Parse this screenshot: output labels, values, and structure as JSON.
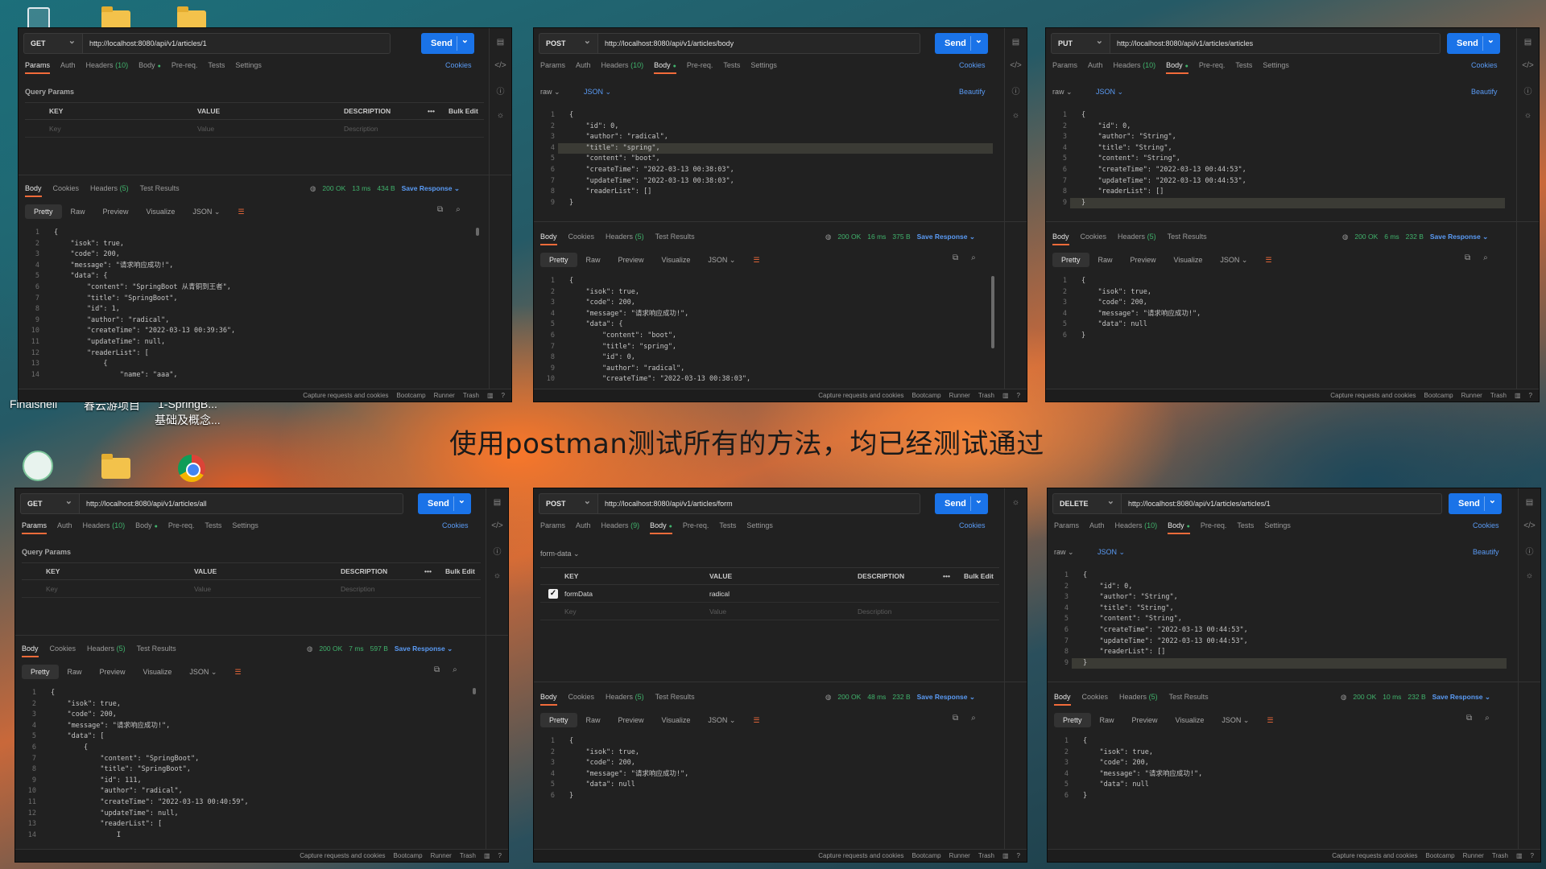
{
  "caption": "使用postman测试所有的方法，均已经测试通过",
  "desktop": {
    "labels": [
      "Finalshell",
      "春云游项目",
      "1-SpringB...",
      "基础及概念..."
    ]
  },
  "common": {
    "send": "Send",
    "cookies": "Cookies",
    "beautify": "Beautify",
    "tabs": {
      "params": "Params",
      "auth": "Auth",
      "body": "Body",
      "prereq": "Pre-req.",
      "tests": "Tests",
      "settings": "Settings"
    },
    "resp_tabs": {
      "body": "Body",
      "cookies": "Cookies",
      "headers": "Headers",
      "headers_count": "(5)",
      "test_results": "Test Results"
    },
    "view": {
      "pretty": "Pretty",
      "raw": "Raw",
      "preview": "Preview",
      "visualize": "Visualize",
      "json": "JSON"
    },
    "save_response": "Save Response ⌄",
    "query_params": "Query Params",
    "kv": {
      "key": "KEY",
      "value": "VALUE",
      "description": "DESCRIPTION",
      "bulk_edit": "Bulk Edit",
      "key_ph": "Key",
      "value_ph": "Value",
      "desc_ph": "Description"
    },
    "body_mode_raw": "raw ⌄",
    "body_lang": "JSON ⌄",
    "form_mode": "form-data ⌄",
    "footer": {
      "capture": "Capture requests and cookies",
      "bootcamp": "Bootcamp",
      "runner": "Runner",
      "trash": "Trash"
    }
  },
  "windows": [
    {
      "id": "get1",
      "method": "GET",
      "url": "http://localhost:8080/api/v1/articles/1",
      "headers_count": "(10)",
      "status": "200 OK",
      "time": "13 ms",
      "size": "434 B",
      "response": {
        "lines": [
          "1",
          "2",
          "3",
          "4",
          "5",
          "6",
          "7",
          "8",
          "9",
          "10",
          "11",
          "12",
          "13",
          "14"
        ],
        "code": "{\n    \"isok\": true,\n    \"code\": 200,\n    \"message\": \"请求响应成功!\",\n    \"data\": {\n        \"content\": \"SpringBoot 从青铜到王者\",\n        \"title\": \"SpringBoot\",\n        \"id\": 1,\n        \"author\": \"radical\",\n        \"createTime\": \"2022-03-13 00:39:36\",\n        \"updateTime\": null,\n        \"readerList\": [\n            {\n                \"name\": \"aaa\","
      }
    },
    {
      "id": "post-body",
      "method": "POST",
      "url": "http://localhost:8080/api/v1/articles/body",
      "headers_count": "(10)",
      "request": {
        "lines": [
          "1",
          "2",
          "3",
          "4",
          "5",
          "6",
          "7",
          "8",
          "9"
        ],
        "code": "{\n    \"id\": 0,\n    \"author\": \"radical\",\n    \"title\": \"spring\",\n    \"content\": \"boot\",\n    \"createTime\": \"2022-03-13 00:38:03\",\n    \"updateTime\": \"2022-03-13 00:38:03\",\n    \"readerList\": []\n}"
      },
      "status": "200 OK",
      "time": "16 ms",
      "size": "375 B",
      "response": {
        "lines": [
          "1",
          "2",
          "3",
          "4",
          "5",
          "6",
          "7",
          "8",
          "9",
          "10"
        ],
        "code": "{\n    \"isok\": true,\n    \"code\": 200,\n    \"message\": \"请求响应成功!\",\n    \"data\": {\n        \"content\": \"boot\",\n        \"title\": \"spring\",\n        \"id\": 0,\n        \"author\": \"radical\",\n        \"createTime\": \"2022-03-13 00:38:03\","
      }
    },
    {
      "id": "put",
      "method": "PUT",
      "url": "http://localhost:8080/api/v1/articles/articles",
      "headers_count": "(10)",
      "request": {
        "lines": [
          "1",
          "2",
          "3",
          "4",
          "5",
          "6",
          "7",
          "8",
          "9"
        ],
        "code": "{\n    \"id\": 0,\n    \"author\": \"String\",\n    \"title\": \"String\",\n    \"content\": \"String\",\n    \"createTime\": \"2022-03-13 00:44:53\",\n    \"updateTime\": \"2022-03-13 00:44:53\",\n    \"readerList\": []\n}"
      },
      "status": "200 OK",
      "time": "6 ms",
      "size": "232 B",
      "response": {
        "lines": [
          "1",
          "2",
          "3",
          "4",
          "5",
          "6"
        ],
        "code": "{\n    \"isok\": true,\n    \"code\": 200,\n    \"message\": \"请求响应成功!\",\n    \"data\": null\n}"
      }
    },
    {
      "id": "get-all",
      "method": "GET",
      "url": "http://localhost:8080/api/v1/articles/all",
      "headers_count": "(10)",
      "status": "200 OK",
      "time": "7 ms",
      "size": "597 B",
      "response": {
        "lines": [
          "1",
          "2",
          "3",
          "4",
          "5",
          "6",
          "7",
          "8",
          "9",
          "10",
          "11",
          "12",
          "13",
          "14"
        ],
        "code": "{\n    \"isok\": true,\n    \"code\": 200,\n    \"message\": \"请求响应成功!\",\n    \"data\": [\n        {\n            \"content\": \"SpringBoot\",\n            \"title\": \"SpringBoot\",\n            \"id\": 111,\n            \"author\": \"radical\",\n            \"createTime\": \"2022-03-13 00:40:59\",\n            \"updateTime\": null,\n            \"readerList\": [\n                I"
      }
    },
    {
      "id": "post-form",
      "method": "POST",
      "url": "http://localhost:8080/api/v1/articles/form",
      "headers_count": "(9)",
      "form": {
        "key": "formData",
        "value": "radical"
      },
      "status": "200 OK",
      "time": "48 ms",
      "size": "232 B",
      "response": {
        "lines": [
          "1",
          "2",
          "3",
          "4",
          "5",
          "6"
        ],
        "code": "{\n    \"isok\": true,\n    \"code\": 200,\n    \"message\": \"请求响应成功!\",\n    \"data\": null\n}"
      }
    },
    {
      "id": "delete",
      "method": "DELETE",
      "url": "http://localhost:8080/api/v1/articles/articles/1",
      "headers_count": "(10)",
      "request": {
        "lines": [
          "1",
          "2",
          "3",
          "4",
          "5",
          "6",
          "7",
          "8",
          "9"
        ],
        "code": "{\n    \"id\": 0,\n    \"author\": \"String\",\n    \"title\": \"String\",\n    \"content\": \"String\",\n    \"createTime\": \"2022-03-13 00:44:53\",\n    \"updateTime\": \"2022-03-13 00:44:53\",\n    \"readerList\": []\n}"
      },
      "status": "200 OK",
      "time": "10 ms",
      "size": "232 B",
      "response": {
        "lines": [
          "1",
          "2",
          "3",
          "4",
          "5",
          "6"
        ],
        "code": "{\n    \"isok\": true,\n    \"code\": 200,\n    \"message\": \"请求响应成功!\",\n    \"data\": null\n}"
      }
    }
  ]
}
